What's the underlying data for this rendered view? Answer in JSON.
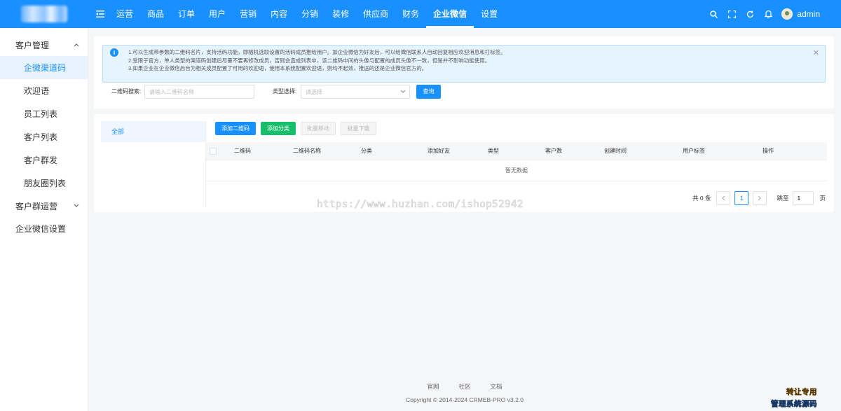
{
  "topbar": {
    "nav": [
      "运营",
      "商品",
      "订单",
      "用户",
      "营销",
      "内容",
      "分销",
      "装修",
      "供应商",
      "财务",
      "企业微信",
      "设置"
    ],
    "active_nav": "企业微信",
    "username": "admin"
  },
  "sidebar": {
    "groups": [
      {
        "label": "客户管理",
        "items": [
          "企微渠道码",
          "欢迎语",
          "员工列表",
          "客户列表",
          "客户群发",
          "朋友圈列表"
        ]
      },
      {
        "label": "客户群运营"
      },
      {
        "label": "企业微信设置"
      }
    ],
    "active_item": "企微渠道码"
  },
  "alert": {
    "lines": [
      "1.可以生成带参数的二维码名片，支持活码功能，即随机选取设置的活码成员推给用户。加企业微信为好友后，可以给微信联系人自动回复相应欢迎消息和打标签。",
      "2.受限于官方，单人类型的渠道码创建后尽量不要再修改成员，否则会造成列表中，该二维码中间的头像与配置的成员头像不一致，但是并不影响功能使用。",
      "3.如果企业在企业微信后台为相关成员配置了可用的欢迎语，使用本系统配置欢迎语，则均不起效，推送的还是企业微信官方的。"
    ]
  },
  "filters": {
    "search_label": "二维码搜索:",
    "search_placeholder": "请输入二维码名称",
    "type_label": "类型选择:",
    "type_placeholder": "请选择",
    "query_button": "查询"
  },
  "categories": [
    "全部"
  ],
  "toolbar": {
    "add_qrcode": "添加二维码",
    "add_category": "添加分类",
    "batch_move": "批量移动",
    "batch_download": "批量下载"
  },
  "table": {
    "columns": [
      "二维码",
      "二维码名称",
      "分类",
      "添加好友",
      "类型",
      "客户数",
      "创建时间",
      "用户标签",
      "操作"
    ],
    "empty_text": "暂无数据"
  },
  "pagination": {
    "total": "共 0 条",
    "current_page": "1",
    "jump_label": "跳至",
    "jump_value": "1",
    "page_suffix": "页"
  },
  "watermark": "https://www.huzhan.com/ishop52942",
  "footer": {
    "links": [
      "官网",
      "社区",
      "文档"
    ],
    "copyright": "Copyright © 2014-2024 CRMEB-PRO v3.2.0"
  },
  "corner_mark": {
    "line1": "转让专用",
    "line2": "管理系统源码"
  }
}
